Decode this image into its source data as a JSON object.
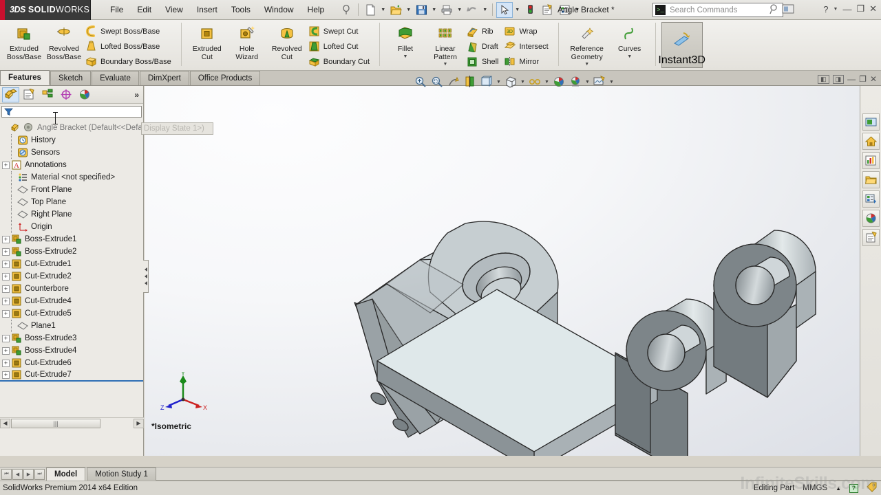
{
  "app": {
    "brand_3ds": "3DS",
    "brand_bold": "SOLID",
    "brand_thin": "WORKS",
    "document_title": "Angle Bracket *",
    "edition": "SolidWorks Premium 2014 x64 Edition",
    "watermark": "InfiniteSkills.com",
    "accent_red": "#c8102e",
    "accent_blue": "#2f6fb5",
    "icon_yellow": "#f5c242",
    "icon_green": "#3f9c35"
  },
  "menu": {
    "items": [
      "File",
      "Edit",
      "View",
      "Insert",
      "Tools",
      "Window",
      "Help"
    ]
  },
  "quick_access": {
    "items": [
      {
        "name": "new-document",
        "glyph": "new"
      },
      {
        "name": "open-document",
        "glyph": "open"
      },
      {
        "name": "save-document",
        "glyph": "save"
      },
      {
        "name": "print-document",
        "glyph": "print"
      },
      {
        "name": "undo",
        "glyph": "undo"
      },
      {
        "name": "select",
        "glyph": "cursor"
      },
      {
        "name": "rebuild",
        "glyph": "traffic"
      },
      {
        "name": "options",
        "glyph": "gear-doc"
      },
      {
        "name": "display-manager",
        "glyph": "list"
      }
    ]
  },
  "search": {
    "placeholder": "Search Commands",
    "icon": "search-commands-icon"
  },
  "window_controls": {
    "help": "?",
    "minimize": "—",
    "restore": "❐",
    "close": "✕"
  },
  "ribbon": {
    "groups": [
      {
        "name": "boss-base",
        "big": [
          {
            "label_line1": "Extruded",
            "label_line2": "Boss/Base",
            "icon": "extruded-boss-icon"
          },
          {
            "label_line1": "Revolved",
            "label_line2": "Boss/Base",
            "icon": "revolved-boss-icon"
          }
        ],
        "small": [
          {
            "label": "Swept Boss/Base",
            "icon": "swept-boss-icon"
          },
          {
            "label": "Lofted Boss/Base",
            "icon": "lofted-boss-icon"
          },
          {
            "label": "Boundary Boss/Base",
            "icon": "boundary-boss-icon"
          }
        ]
      },
      {
        "name": "cut",
        "big": [
          {
            "label_line1": "Extruded",
            "label_line2": "Cut",
            "icon": "extruded-cut-icon"
          },
          {
            "label_line1": "Hole",
            "label_line2": "Wizard",
            "icon": "hole-wizard-icon"
          },
          {
            "label_line1": "Revolved",
            "label_line2": "Cut",
            "icon": "revolved-cut-icon"
          }
        ],
        "small": [
          {
            "label": "Swept Cut",
            "icon": "swept-cut-icon"
          },
          {
            "label": "Lofted Cut",
            "icon": "lofted-cut-icon"
          },
          {
            "label": "Boundary Cut",
            "icon": "boundary-cut-icon"
          }
        ]
      },
      {
        "name": "features",
        "big": [
          {
            "label_line1": "Fillet",
            "label_line2": "",
            "icon": "fillet-icon",
            "has_dropdown": true
          },
          {
            "label_line1": "Linear",
            "label_line2": "Pattern",
            "icon": "linear-pattern-icon",
            "has_dropdown": true
          }
        ],
        "small": [
          {
            "label": "Rib",
            "icon": "rib-icon"
          },
          {
            "label": "Draft",
            "icon": "draft-icon"
          },
          {
            "label": "Shell",
            "icon": "shell-icon"
          }
        ],
        "small2": [
          {
            "label": "Wrap",
            "icon": "wrap-icon"
          },
          {
            "label": "Intersect",
            "icon": "intersect-icon"
          },
          {
            "label": "Mirror",
            "icon": "mirror-icon"
          }
        ]
      },
      {
        "name": "reference",
        "big": [
          {
            "label_line1": "Reference",
            "label_line2": "Geometry",
            "icon": "reference-geometry-icon",
            "has_dropdown": true
          },
          {
            "label_line1": "Curves",
            "label_line2": "",
            "icon": "curves-icon",
            "has_dropdown": true
          }
        ]
      }
    ],
    "instant3d": {
      "label": "Instant3D",
      "icon": "instant3d-icon",
      "active": true
    }
  },
  "command_tabs": {
    "items": [
      {
        "label": "Features",
        "active": true
      },
      {
        "label": "Sketch",
        "active": false
      },
      {
        "label": "Evaluate",
        "active": false
      },
      {
        "label": "DimXpert",
        "active": false
      },
      {
        "label": "Office Products",
        "active": false
      }
    ]
  },
  "view_toolbar": {
    "items": [
      {
        "name": "zoom-to-fit-icon"
      },
      {
        "name": "zoom-to-area-icon"
      },
      {
        "name": "previous-view-icon"
      },
      {
        "name": "section-view-icon"
      },
      {
        "name": "view-orientation-icon",
        "dropdown": true
      },
      {
        "name": "display-style-icon",
        "dropdown": true
      },
      {
        "name": "hide-show-items-icon",
        "dropdown": true
      },
      {
        "name": "edit-appearance-icon"
      },
      {
        "name": "apply-scene-icon",
        "dropdown": true
      },
      {
        "name": "view-settings-icon",
        "dropdown": true
      }
    ],
    "right_items": [
      {
        "name": "tile-horizontally-icon"
      },
      {
        "name": "tile-vertically-icon"
      },
      {
        "name": "minimize-window-icon"
      },
      {
        "name": "restore-window-icon"
      },
      {
        "name": "close-window-icon"
      }
    ]
  },
  "left_panel": {
    "tabs": [
      {
        "name": "feature-manager-tab",
        "icon": "feature-tree-icon",
        "active": true
      },
      {
        "name": "property-manager-tab",
        "icon": "property-manager-icon",
        "active": false
      },
      {
        "name": "configuration-manager-tab",
        "icon": "configuration-icon",
        "active": false
      },
      {
        "name": "dimxpert-manager-tab",
        "icon": "dimxpert-icon",
        "active": false
      },
      {
        "name": "display-manager-tab",
        "icon": "appearance-ball-icon",
        "active": false
      }
    ],
    "more_glyph": "»",
    "filter_placeholder": "",
    "filter_icon": "filter-icon"
  },
  "feature_tree": {
    "root": {
      "label": "Angle Bracket  (Default<<Defau",
      "overlay_label": "Display State 1>)",
      "icon": "part-icon"
    },
    "items": [
      {
        "label": "History",
        "icon": "history-icon",
        "expandable": false,
        "indent": 1
      },
      {
        "label": "Sensors",
        "icon": "sensors-icon",
        "expandable": false,
        "indent": 1
      },
      {
        "label": "Annotations",
        "icon": "annotations-icon",
        "expandable": true,
        "indent": 1
      },
      {
        "label": "Material <not specified>",
        "icon": "material-icon",
        "expandable": false,
        "indent": 1
      },
      {
        "label": "Front Plane",
        "icon": "plane-icon",
        "expandable": false,
        "indent": 1
      },
      {
        "label": "Top Plane",
        "icon": "plane-icon",
        "expandable": false,
        "indent": 1
      },
      {
        "label": "Right Plane",
        "icon": "plane-icon",
        "expandable": false,
        "indent": 1
      },
      {
        "label": "Origin",
        "icon": "origin-icon",
        "expandable": false,
        "indent": 1
      },
      {
        "label": "Boss-Extrude1",
        "icon": "boss-extrude-icon",
        "expandable": true,
        "indent": 1
      },
      {
        "label": "Boss-Extrude2",
        "icon": "boss-extrude-icon",
        "expandable": true,
        "indent": 1
      },
      {
        "label": "Cut-Extrude1",
        "icon": "cut-extrude-icon",
        "expandable": true,
        "indent": 1
      },
      {
        "label": "Cut-Extrude2",
        "icon": "cut-extrude-icon",
        "expandable": true,
        "indent": 1
      },
      {
        "label": "Counterbore",
        "icon": "cut-extrude-icon",
        "expandable": true,
        "indent": 1
      },
      {
        "label": "Cut-Extrude4",
        "icon": "cut-extrude-icon",
        "expandable": true,
        "indent": 1
      },
      {
        "label": "Cut-Extrude5",
        "icon": "cut-extrude-icon",
        "expandable": true,
        "indent": 1
      },
      {
        "label": "Plane1",
        "icon": "plane-icon",
        "expandable": false,
        "indent": 1
      },
      {
        "label": "Boss-Extrude3",
        "icon": "boss-extrude-icon",
        "expandable": true,
        "indent": 1
      },
      {
        "label": "Boss-Extrude4",
        "icon": "boss-extrude-icon",
        "expandable": true,
        "indent": 1
      },
      {
        "label": "Cut-Extrude6",
        "icon": "cut-extrude-icon",
        "expandable": true,
        "indent": 1
      },
      {
        "label": "Cut-Extrude7",
        "icon": "cut-extrude-icon",
        "expandable": true,
        "indent": 1,
        "selected": true
      }
    ]
  },
  "graphics": {
    "view_label": "*Isometric",
    "triad": {
      "x_label": "X",
      "y_label": "Y",
      "z_label": "Z",
      "x_color": "#cc2222",
      "y_color": "#1a8a1a",
      "z_color": "#2222cc"
    },
    "model_name": "angle-bracket-model"
  },
  "task_pane": {
    "buttons": [
      {
        "name": "solidworks-resources-button",
        "icon": "panel-icon"
      },
      {
        "name": "design-library-button",
        "icon": "home-icon"
      },
      {
        "name": "file-explorer-button",
        "icon": "chart-icon"
      },
      {
        "name": "search-folder-button",
        "icon": "folder-icon"
      },
      {
        "name": "view-palette-button",
        "icon": "layout-icon"
      },
      {
        "name": "appearances-scenes-button",
        "icon": "appearance-ball-icon"
      },
      {
        "name": "custom-properties-button",
        "icon": "properties-icon"
      }
    ]
  },
  "bottom": {
    "nav": [
      "⏮",
      "◀",
      "▶",
      "⏭"
    ],
    "tabs": [
      {
        "label": "Model",
        "active": true
      },
      {
        "label": "Motion Study 1",
        "active": false
      }
    ]
  },
  "status_bar": {
    "left": "SolidWorks Premium 2014 x64 Edition",
    "editing_state": "Editing Part",
    "units": "MMGS",
    "units_arrow": "▲",
    "indicator": "?",
    "tag_icon": "tag-icon"
  }
}
